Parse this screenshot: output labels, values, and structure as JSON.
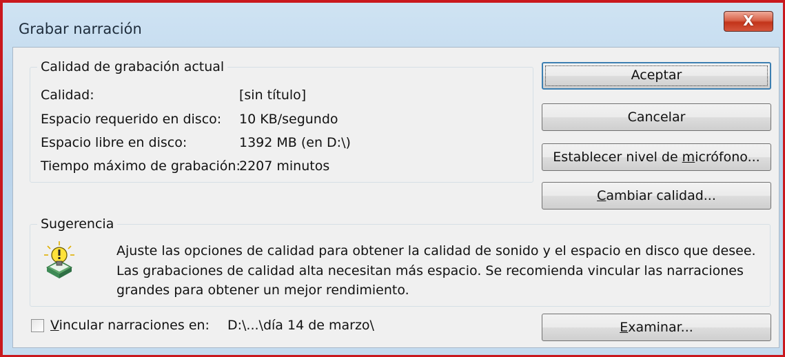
{
  "window": {
    "title": "Grabar narración",
    "close_label": "X"
  },
  "quality_group": {
    "legend": "Calidad de grabación actual",
    "rows": [
      {
        "label": "Calidad:",
        "value": "[sin título]"
      },
      {
        "label": "Espacio requerido en disco:",
        "value": "10 KB/segundo"
      },
      {
        "label": "Espacio libre en disco:",
        "value": "1392 MB (en D:\\)"
      },
      {
        "label": "Tiempo máximo de grabación:",
        "value": "2207 minutos"
      }
    ]
  },
  "buttons": {
    "accept": "Aceptar",
    "cancel": "Cancelar",
    "mic_pre": "Establecer nivel de ",
    "mic_u": "m",
    "mic_post": "icrófono...",
    "quality_u": "C",
    "quality_post": "ambiar calidad...",
    "browse_u": "E",
    "browse_post": "xaminar..."
  },
  "hint_group": {
    "legend": "Sugerencia",
    "lines": [
      "Ajuste las opciones de calidad para obtener la calidad de sonido y el espacio en disco que desee.",
      "Las grabaciones de calidad alta necesitan más espacio. Se recomienda vincular las narraciones",
      "grandes para obtener un mejor rendimiento."
    ]
  },
  "link": {
    "checked": false,
    "label_u": "V",
    "label_post": "incular narraciones en:",
    "path": "D:\\...\\día 14 de marzo\\"
  }
}
